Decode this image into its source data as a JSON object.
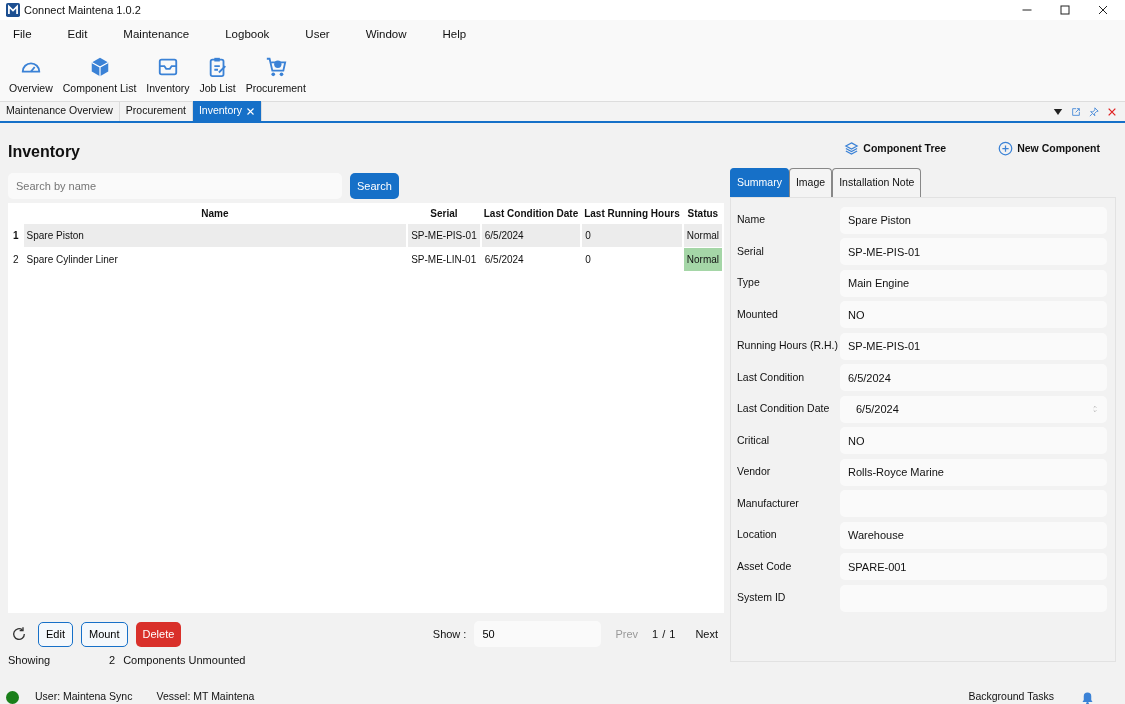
{
  "window": {
    "title": "Connect Maintena 1.0.2"
  },
  "menu": [
    "File",
    "Edit",
    "Maintenance",
    "Logbook",
    "User",
    "Window",
    "Help"
  ],
  "toolbar": [
    {
      "kind": "gauge",
      "label": "Overview"
    },
    {
      "kind": "cube",
      "label": "Component List"
    },
    {
      "kind": "inbox",
      "label": "Inventory"
    },
    {
      "kind": "clipboard",
      "label": "Job List"
    },
    {
      "kind": "cart",
      "label": "Procurement"
    }
  ],
  "doc_tabs": [
    {
      "label": "Maintenance Overview",
      "selected": false,
      "closable": false
    },
    {
      "label": "Procurement",
      "selected": false,
      "closable": false
    },
    {
      "label": "Inventory",
      "selected": true,
      "closable": true
    }
  ],
  "page_title": "Inventory",
  "search": {
    "placeholder": "Search by name",
    "button": "Search"
  },
  "header_actions": [
    {
      "kind": "layers",
      "label": "Component Tree"
    },
    {
      "kind": "plus",
      "label": "New Component"
    }
  ],
  "table": {
    "columns": [
      "Name",
      "Serial",
      "Last Condition Date",
      "Last Running Hours",
      "Status"
    ],
    "rows": [
      {
        "index": "1",
        "selected": true,
        "cells": [
          "Spare Piston",
          "SP-ME-PIS-01",
          "6/5/2024",
          "0",
          "Normal"
        ]
      },
      {
        "index": "2",
        "selected": false,
        "cells": [
          "Spare Cylinder Liner",
          "SP-ME-LIN-01",
          "6/5/2024",
          "0",
          "Normal"
        ]
      }
    ]
  },
  "actions": [
    {
      "kind": "outline",
      "label": "Edit"
    },
    {
      "kind": "outline",
      "label": "Mount"
    },
    {
      "kind": "danger",
      "label": "Delete"
    }
  ],
  "pager": {
    "show_label": "Show :",
    "page_size": "50",
    "prev": "Prev",
    "page": "1",
    "sep": "/",
    "pages": "1",
    "next": "Next"
  },
  "summary": {
    "showing": "Showing",
    "count": "2",
    "text": "Components Unmounted"
  },
  "detail_tabs": [
    {
      "label": "Summary",
      "selected": true
    },
    {
      "label": "Image",
      "selected": false
    },
    {
      "label": "Installation Note",
      "selected": false
    }
  ],
  "fields": [
    {
      "kind": "text",
      "label": "Name",
      "value": "Spare Piston"
    },
    {
      "kind": "text",
      "label": "Serial",
      "value": "SP-ME-PIS-01"
    },
    {
      "kind": "text",
      "label": "Type",
      "value": "Main Engine"
    },
    {
      "kind": "text",
      "label": "Mounted",
      "value": "NO"
    },
    {
      "kind": "text",
      "label": "Running Hours (R.H.)",
      "value": "SP-ME-PIS-01"
    },
    {
      "kind": "text",
      "label": "Last Condition",
      "value": "6/5/2024"
    },
    {
      "kind": "spin",
      "label": "Last Condition Date",
      "value": "6/5/2024"
    },
    {
      "kind": "text",
      "label": "Critical",
      "value": "NO"
    },
    {
      "kind": "text",
      "label": "Vendor",
      "value": "Rolls-Royce Marine"
    },
    {
      "kind": "text",
      "label": "Manufacturer"
    },
    {
      "kind": "text",
      "label": "Location",
      "value": "Warehouse"
    },
    {
      "kind": "text",
      "label": "Asset Code",
      "value": "SPARE-001"
    },
    {
      "kind": "text",
      "label": "System ID"
    }
  ],
  "status_bar": {
    "connected": true,
    "user": "User: Maintena Sync",
    "vessel": "Vessel: MT Maintena",
    "tasks": "Background Tasks"
  }
}
